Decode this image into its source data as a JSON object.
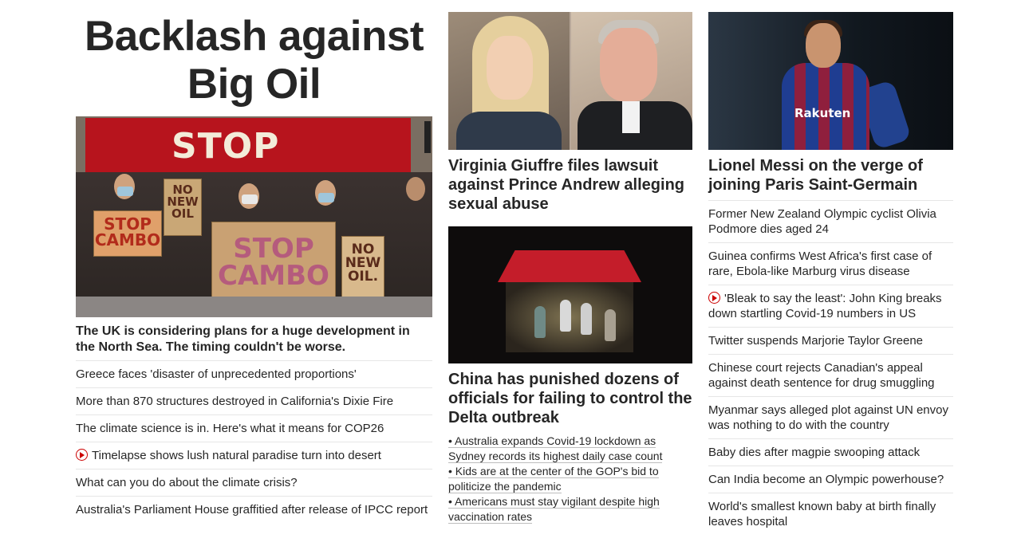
{
  "left": {
    "section_title": "Backlash against Big Oil",
    "hero_image": {
      "banner_text": "STOP CAMBO",
      "signs": [
        "STOP CAMBO",
        "NO NEW OIL",
        "STOP CAMBO",
        "NO NEW OIL."
      ]
    },
    "hero_headline": "The UK is considering plans for a huge development in the North Sea. The timing couldn't be worse.",
    "links": [
      {
        "text": "Greece faces 'disaster of unprecedented proportions'",
        "video": false
      },
      {
        "text": "More than 870 structures destroyed in California's Dixie Fire",
        "video": false
      },
      {
        "text": "The climate science is in. Here's what it means for COP26",
        "video": false
      },
      {
        "text": "Timelapse shows lush natural paradise turn into desert",
        "video": true
      },
      {
        "text": "What can you do about the climate crisis?",
        "video": false
      },
      {
        "text": "Australia's Parliament House graffitied after release of IPCC report",
        "video": false
      }
    ]
  },
  "middle": {
    "story1": {
      "headline": "Virginia Giuffre files lawsuit against Prince Andrew alleging sexual abuse"
    },
    "story2": {
      "headline": "China has punished dozens of officials for failing to control the Delta outbreak",
      "bullets": [
        "• Australia expands Covid-19 lockdown as Sydney records its highest daily case count",
        "• Kids are at the center of the GOP's bid to politicize the pandemic",
        "• Americans must stay vigilant despite high vaccination rates"
      ]
    }
  },
  "right": {
    "story": {
      "headline": "Lionel Messi on the verge of joining Paris Saint-Germain",
      "image_sponsor_text": "Rakuten"
    },
    "links": [
      {
        "text": "Former New Zealand Olympic cyclist Olivia Podmore dies aged 24",
        "video": false
      },
      {
        "text": "Guinea confirms West Africa's first case of rare, Ebola-like Marburg virus disease",
        "video": false
      },
      {
        "text": "'Bleak to say the least': John King breaks down startling Covid-19 numbers in US",
        "video": true
      },
      {
        "text": "Twitter suspends Marjorie Taylor Greene",
        "video": false
      },
      {
        "text": "Chinese court rejects Canadian's appeal against death sentence for drug smuggling",
        "video": false
      },
      {
        "text": "Myanmar says alleged plot against UN envoy was nothing to do with the country",
        "video": false
      },
      {
        "text": "Baby dies after magpie swooping attack",
        "video": false
      },
      {
        "text": "Can India become an Olympic powerhouse?",
        "video": false
      },
      {
        "text": "World's smallest known baby at birth finally leaves hospital",
        "video": false
      }
    ]
  },
  "colors": {
    "text": "#262626",
    "divider": "#e6e6e6",
    "video_icon": "#cc0000"
  }
}
